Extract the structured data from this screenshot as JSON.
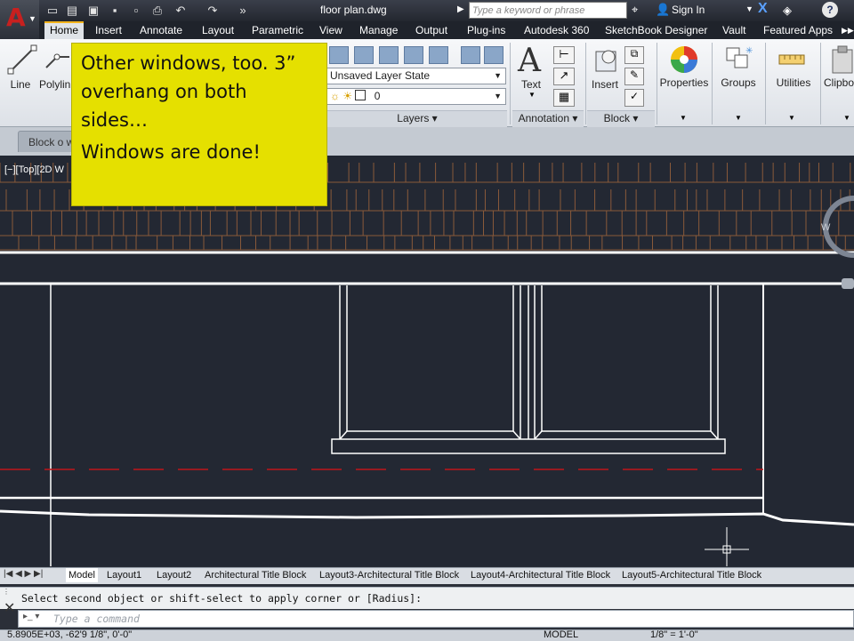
{
  "window": {
    "title": "floor plan.dwg",
    "app_icon": "autocad-a-logo",
    "search_placeholder": "Type a keyword or phrase",
    "signin_label": "Sign In",
    "help_label": "?"
  },
  "ribbon_tabs": [
    "Home",
    "Insert",
    "Annotate",
    "Layout",
    "Parametric",
    "View",
    "Manage",
    "Output",
    "Plug-ins",
    "Autodesk 360",
    "SketchBook Designer",
    "Vault",
    "Featured Apps"
  ],
  "active_tab": "Home",
  "ribbon": {
    "draw": {
      "line_label": "Line",
      "polyline_label": "Polylin"
    },
    "layers": {
      "layer_state": "Unsaved Layer State",
      "current_layer": "0",
      "panel_label": "Layers"
    },
    "annotation": {
      "text_label": "Text",
      "panel_label": "Annotation"
    },
    "block": {
      "insert_label": "Insert",
      "panel_label": "Block"
    },
    "properties_label": "Properties",
    "groups_label": "Groups",
    "utilities_label": "Utilities",
    "clipboard_label": "Clipbo"
  },
  "file_tab": "Block o w",
  "viewport_label": "[−][Top][2D W",
  "callout": {
    "line1": "Other windows, too.  3” overhang on both sides…",
    "line2": "Windows are done!"
  },
  "layout_tabs": [
    "Model",
    "Layout1",
    "Layout2",
    "Architectural Title Block",
    "Layout3-Architectural Title Block",
    "Layout4-Architectural Title Block",
    "Layout5-Architectural Title Block"
  ],
  "active_layout": "Model",
  "command": {
    "history": "Select second object or shift-select to apply corner or [Radius]:",
    "placeholder": "Type a command"
  },
  "status": {
    "coords": "5.8905E+03, -62'9 1/8\", 0'-0\"",
    "model_label": "MODEL",
    "scale": "1/8\" = 1'-0\""
  },
  "colors": {
    "canvas": "#232833",
    "callout": "#e5e000",
    "hidden_line": "#c0161b",
    "shingle": "#8a5a3a"
  }
}
